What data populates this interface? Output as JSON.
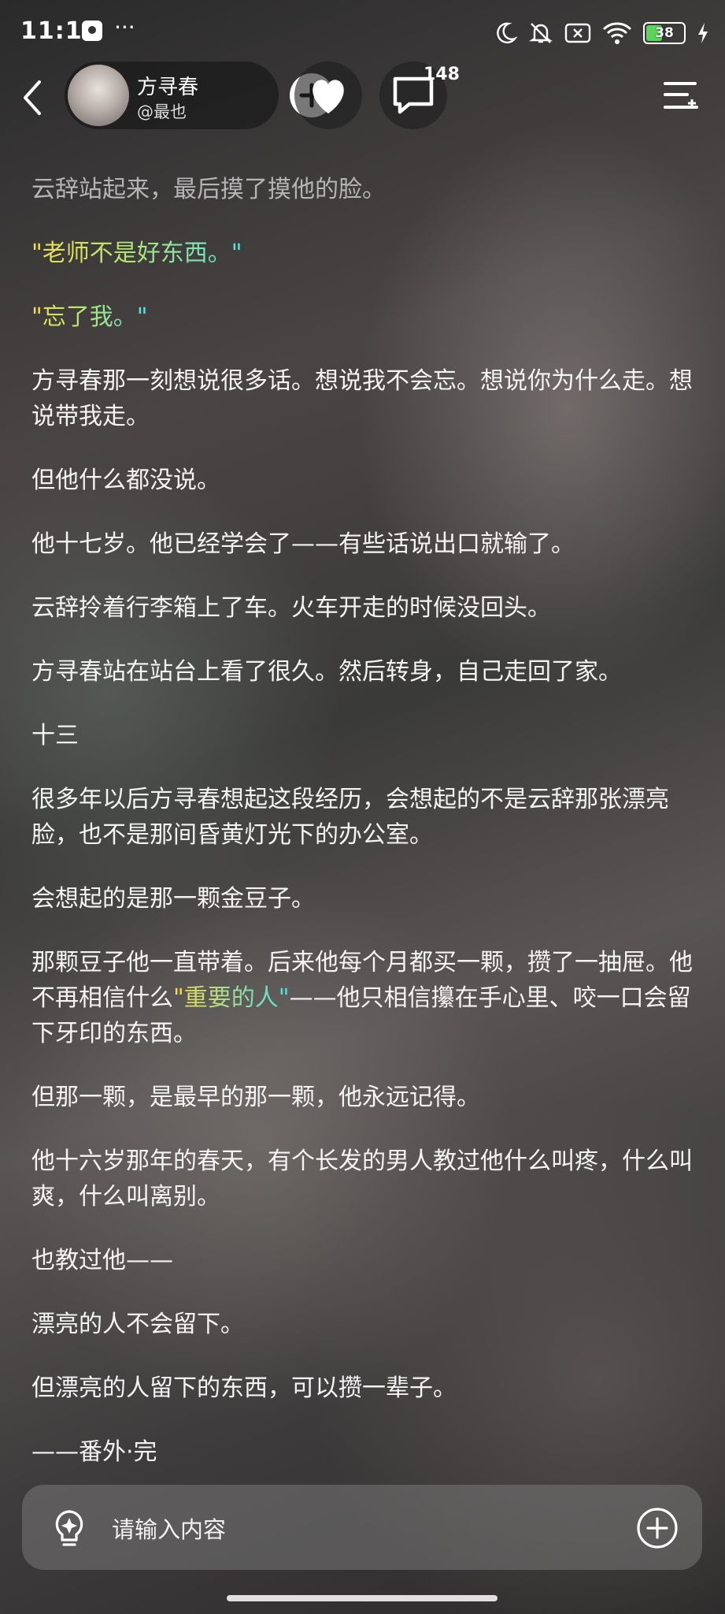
{
  "status_bar": {
    "time": "11:11",
    "more": "···",
    "battery": "38"
  },
  "header": {
    "author_name": "方寻春",
    "author_handle": "@最也",
    "comment_count": "148"
  },
  "article": {
    "p0": "云辞站起来，最后摸了摸他的脸。",
    "p1": "\"老师不是好东西。\"",
    "p2": "\"忘了我。\"",
    "p3": "方寻春那一刻想说很多话。想说我不会忘。想说你为什么走。想说带我走。",
    "p4": "但他什么都没说。",
    "p5": "他十七岁。他已经学会了——有些话说出口就输了。",
    "p6": "云辞拎着行李箱上了车。火车开走的时候没回头。",
    "p7": "方寻春站在站台上看了很久。然后转身，自己走回了家。",
    "p8": "十三",
    "p9": "很多年以后方寻春想起这段经历，会想起的不是云辞那张漂亮脸，也不是那间昏黄灯光下的办公室。",
    "p10": "会想起的是那一颗金豆子。",
    "p11_a": "那颗豆子他一直带着。后来他每个月都买一颗，攒了一抽屉。他不再相信什么",
    "p11_hl": "\"重要的人\"",
    "p11_b": "——他只相信攥在手心里、咬一口会留下牙印的东西。",
    "p12": "但那一颗，是最早的那一颗，他永远记得。",
    "p13": "他十六岁那年的春天，有个长发的男人教过他什么叫疼，什么叫爽，什么叫离别。",
    "p14": "也教过他——",
    "p15": "漂亮的人不会留下。",
    "p16": "但漂亮的人留下的东西，可以攒一辈子。",
    "p17": "——番外·完"
  },
  "input": {
    "placeholder": "请输入内容"
  },
  "colors": {
    "dialog_gradient_start": "#f5dc52",
    "dialog_gradient_end": "#5fe0d8",
    "battery_fill": "#5bd45b"
  }
}
